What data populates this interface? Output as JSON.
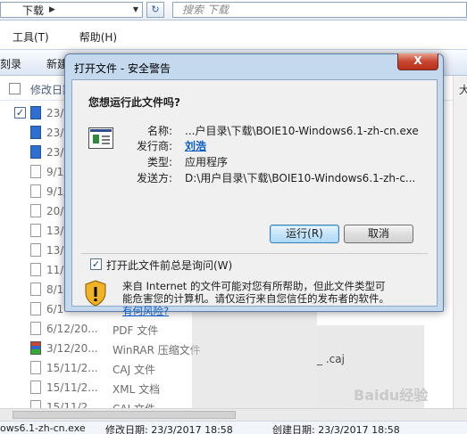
{
  "explorer": {
    "address": "下载",
    "search_placeholder": "搜索 下载",
    "menu": [
      "工具(T)",
      "帮助(H)"
    ],
    "toolbar": [
      "刻录",
      "新建"
    ],
    "column_header": "修改日期",
    "rows": [
      {
        "date": "23/3",
        "type": "",
        "icon": "ie-icon",
        "checked": true
      },
      {
        "date": "23/3",
        "type": "",
        "icon": "app-icon"
      },
      {
        "date": "23/3",
        "type": "",
        "icon": "setup-icon"
      },
      {
        "date": "9/1/",
        "type": "",
        "icon": "file-icon"
      },
      {
        "date": "9/1/",
        "type": "",
        "icon": "file-icon"
      },
      {
        "date": "20/1",
        "type": "",
        "icon": "file-icon"
      },
      {
        "date": "13/1",
        "type": "",
        "icon": "file-icon"
      },
      {
        "date": "13/1",
        "type": "",
        "icon": "file-icon"
      },
      {
        "date": "11/1",
        "type": "",
        "icon": "file-icon"
      },
      {
        "date": "8/12",
        "type": "",
        "icon": "file-icon"
      },
      {
        "date": "6/1",
        "type": "",
        "icon": "file-icon"
      },
      {
        "date": "6/12/20...",
        "type": "PDF 文件",
        "icon": "file-icon"
      },
      {
        "date": "3/12/20...",
        "type": "WinRAR 压缩文件",
        "icon": "rar-icon"
      },
      {
        "date": "15/11/2...",
        "type": "CAJ 文件",
        "icon": "file-icon"
      },
      {
        "date": "15/11/2...",
        "type": "XML 文档",
        "icon": "file-icon"
      },
      {
        "date": "15/11/2...",
        "type": "CAJ 文件",
        "icon": "file-icon"
      }
    ],
    "file_note": "_ .caj",
    "status": {
      "filename": "ows6.1-zh-cn.exe",
      "modified": "修改日期: 23/3/2017 18:58",
      "created": "创建日期: 23/3/2017 18:58"
    },
    "watermark": "Baidu经验"
  },
  "dialog": {
    "title": "打开文件 - 安全警告",
    "close": "X",
    "question": "您想运行此文件吗?",
    "fields": {
      "name_label": "名称:",
      "name_value": "...户目录\\下载\\BOIE10-Windows6.1-zh-cn.exe",
      "publisher_label": "发行商:",
      "publisher_value": "刘浩",
      "type_label": "类型:",
      "type_value": "应用程序",
      "from_label": "发送方:",
      "from_value": "D:\\用户目录\\下载\\BOIE10-Windows6.1-zh-c..."
    },
    "run_button": "运行(R)",
    "cancel_button": "取消",
    "always_ask": "打开此文件前总是询问(W)",
    "always_ask_checked": true,
    "warning_line1": "来自 Internet 的文件可能对您有所帮助，但此文件类型可",
    "warning_line2": "能危害您的计算机。请仅运行来自您信任的发布者的软件。",
    "warning_link": "有何风险?"
  }
}
